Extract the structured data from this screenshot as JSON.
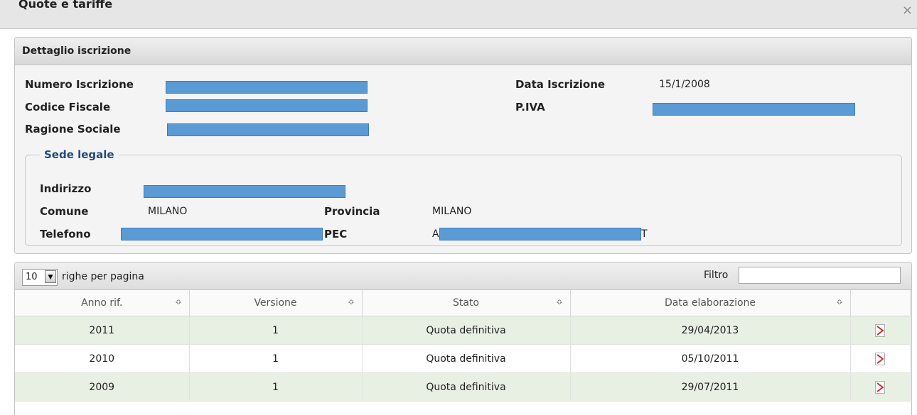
{
  "window": {
    "title": "Quote e tariffe",
    "close_label": "×"
  },
  "detail": {
    "header": "Dettaglio iscrizione",
    "numero_iscrizione_label": "Numero Iscrizione",
    "data_iscrizione_label": "Data Iscrizione",
    "data_iscrizione_value": "15/1/2008",
    "codice_fiscale_label": "Codice Fiscale",
    "piva_label": "P.IVA",
    "ragione_sociale_label": "Ragione Sociale",
    "sede": {
      "legend": "Sede legale",
      "indirizzo_label": "Indirizzo",
      "comune_label": "Comune",
      "comune_value": "MILANO",
      "provincia_label": "Provincia",
      "provincia_value": "MILANO",
      "telefono_label": "Telefono",
      "pec_label": "PEC",
      "pec_prefix": "A",
      "pec_suffix": "T"
    }
  },
  "grid": {
    "page_size": "10",
    "per_page_label": "righe per pagina",
    "filter_label": "Filtro",
    "filter_value": "",
    "columns": [
      "Anno rif.",
      "Versione",
      "Stato",
      "Data elaborazione"
    ],
    "rows": [
      {
        "anno": "2011",
        "versione": "1",
        "stato": "Quota definitiva",
        "data": "29/04/2013",
        "icon": "pdf-icon"
      },
      {
        "anno": "2010",
        "versione": "1",
        "stato": "Quota definitiva",
        "data": "05/10/2011",
        "icon": "pdf-icon"
      },
      {
        "anno": "2009",
        "versione": "1",
        "stato": "Quota definitiva",
        "data": "29/07/2011",
        "icon": "pdf-icon"
      }
    ]
  },
  "colors": {
    "redaction": "#5b9bd5",
    "row_alt": "#e8efe3",
    "legend": "#24497a"
  }
}
